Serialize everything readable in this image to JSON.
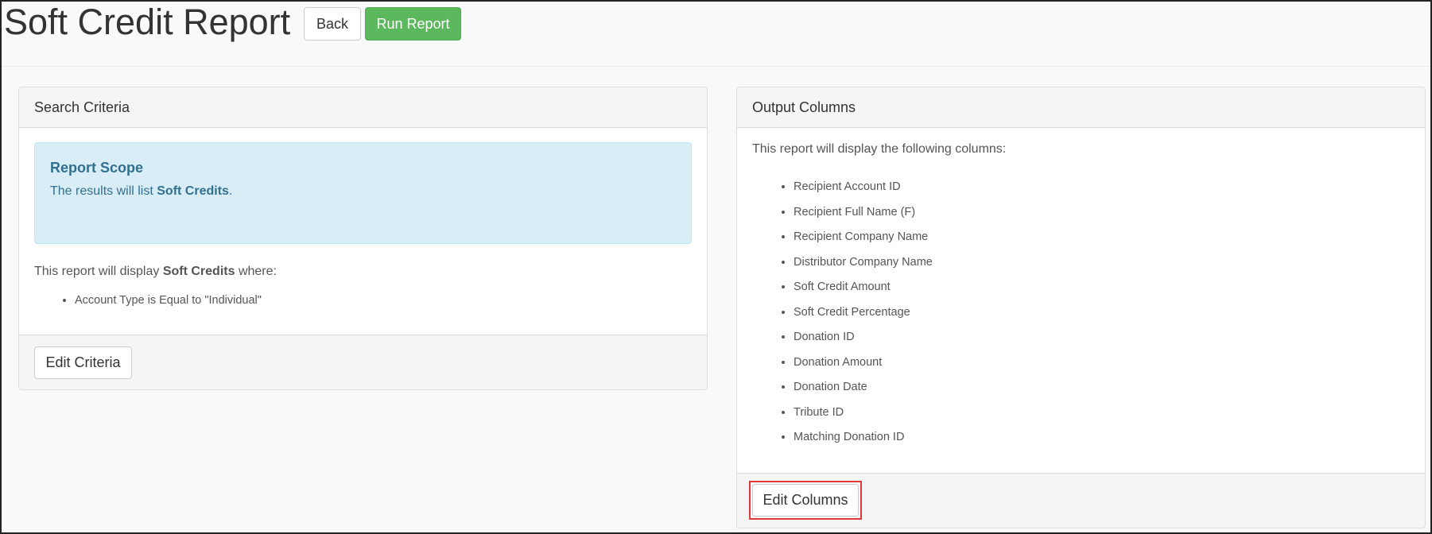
{
  "header": {
    "title": "Soft Credit Report",
    "back_label": "Back",
    "run_label": "Run Report"
  },
  "search_criteria": {
    "heading": "Search Criteria",
    "scope": {
      "title": "Report Scope",
      "text_prefix": "The results will list ",
      "text_bold": "Soft Credits",
      "text_suffix": "."
    },
    "intro_prefix": "This report will display ",
    "intro_bold": "Soft Credits",
    "intro_suffix": " where:",
    "criteria": [
      "Account Type is Equal to \"Individual\""
    ],
    "edit_label": "Edit Criteria"
  },
  "output_columns": {
    "heading": "Output Columns",
    "intro": "This report will display the following columns:",
    "columns": [
      "Recipient Account ID",
      "Recipient Full Name (F)",
      "Recipient Company Name",
      "Distributor Company Name",
      "Soft Credit Amount",
      "Soft Credit Percentage",
      "Donation ID",
      "Donation Amount",
      "Donation Date",
      "Tribute ID",
      "Matching Donation ID"
    ],
    "edit_label": "Edit Columns"
  },
  "colors": {
    "success": "#5cb85c",
    "info_bg": "#d9edf7",
    "info_text": "#31708f",
    "highlight": "#e0393e"
  }
}
